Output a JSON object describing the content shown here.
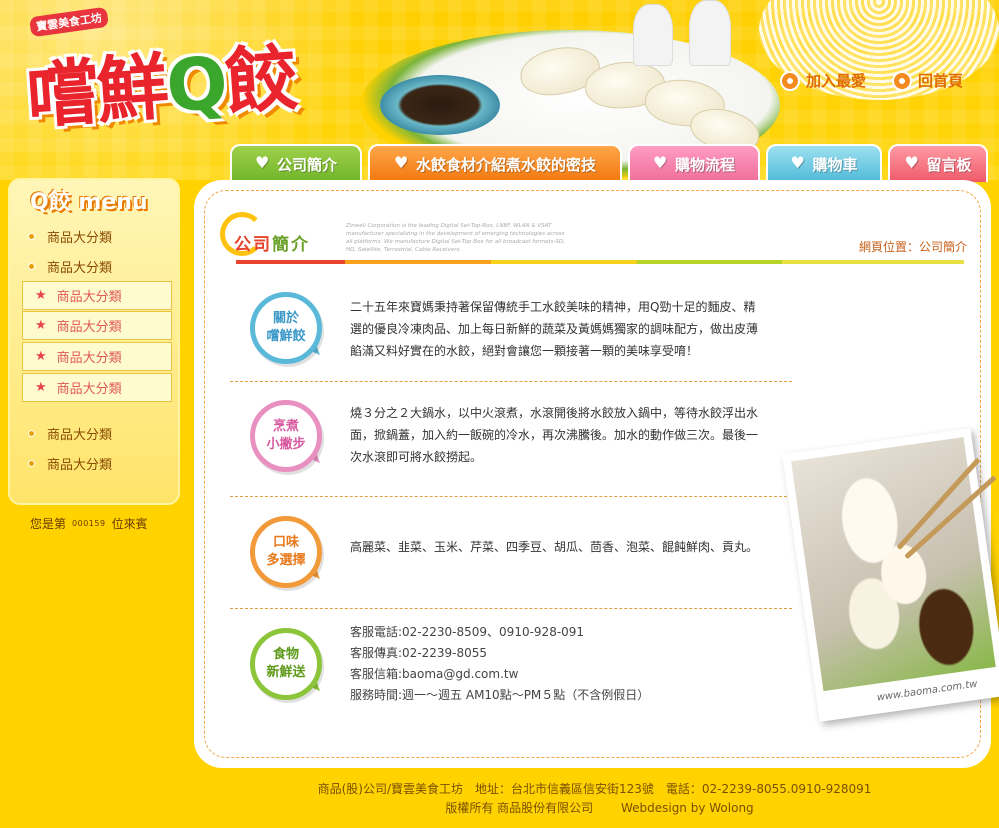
{
  "header": {
    "logo_sub": "寶雲美食工坊",
    "logo_main_a": "嚐鮮",
    "logo_main_q": "Q",
    "logo_main_b": "餃",
    "links": [
      {
        "label": "加入最愛"
      },
      {
        "label": "回首頁"
      }
    ]
  },
  "nav": {
    "tabs": [
      {
        "label": "公司簡介"
      },
      {
        "label": "水餃食材介紹煮水餃的密技"
      },
      {
        "label": "購物流程"
      },
      {
        "label": "購物車"
      },
      {
        "label": "留言板"
      }
    ]
  },
  "sidebar": {
    "title": "Q餃 menu",
    "items": [
      {
        "label": "商品大分類"
      },
      {
        "label": "商品大分類"
      },
      {
        "label": "商品大分類"
      },
      {
        "label": "商品大分類"
      }
    ],
    "sub_items": [
      {
        "label": "商品大分類"
      },
      {
        "label": "商品大分類"
      },
      {
        "label": "商品大分類"
      },
      {
        "label": "商品大分類"
      }
    ],
    "visitor_prefix": "您是第",
    "visitor_count": "000159",
    "visitor_suffix": "位來賓"
  },
  "main": {
    "section_title_a": "公司",
    "section_title_b": "簡介",
    "tiny_text": "Zinwell Corporation is the leading Digital Set-Top-Box, LNBF, WLAN & VSAT manufacturer specializing in the development of emerging technologies across all platforms. We manufacture Digital Set-Top-Box for all broadcast formats-SD, HD, Satellite, Terrestrial, Cable Receivers.",
    "breadcrumb": "網頁位置：公司簡介",
    "rows": [
      {
        "badge_line1": "關於",
        "badge_line2": "嚐鮮餃",
        "text": "二十五年來寶媽秉持著保留傳統手工水餃美味的精神，用Q勁十足的麵皮、精選的優良冷凍肉品、加上每日新鮮的蔬菜及黃媽媽獨家的調味配方，做出皮薄餡滿又料好實在的水餃，絕對會讓您一顆接著一顆的美味享受唷！"
      },
      {
        "badge_line1": "烹煮",
        "badge_line2": "小撇步",
        "text": "燒３分之２大鍋水，以中火滾煮，水滾開後將水餃放入鍋中，等待水餃浮出水面，掀鍋蓋，加入約一飯碗的冷水，再次沸騰後。加水的動作做三次。最後一次水滾即可將水餃撈起。"
      },
      {
        "badge_line1": "口味",
        "badge_line2": "多選擇",
        "text": "高麗菜、韭菜、玉米、芹菜、四季豆、胡瓜、茴香、泡菜、餛飩鮮肉、貢丸。"
      },
      {
        "badge_line1": "食物",
        "badge_line2": "新鮮送",
        "contact": [
          "客服電話:02-2230-8509、0910-928-091",
          "客服傳真:02-2239-8055",
          "客服信箱:baoma@gd.com.tw",
          "服務時間:週一～週五 AM10點～PM５點（不含例假日）"
        ]
      }
    ],
    "photo_caption": "www.baoma.com.tw"
  },
  "footer": {
    "line1": "商品(股)公司/寶雲美食工坊　地址：台北市信義區信安街123號　電話：02-2239-8055.0910-928091",
    "line2": "版權所有 商品股份有限公司　　 Webdesign by Wolong"
  },
  "colors": {
    "background": "#ffd200",
    "accent_red": "#e8442c",
    "accent_green": "#6aa22a",
    "badge_blue": "#5ab8d8",
    "badge_pink": "#e890c0",
    "badge_orange": "#f29a3a",
    "badge_green": "#8cc43a"
  }
}
